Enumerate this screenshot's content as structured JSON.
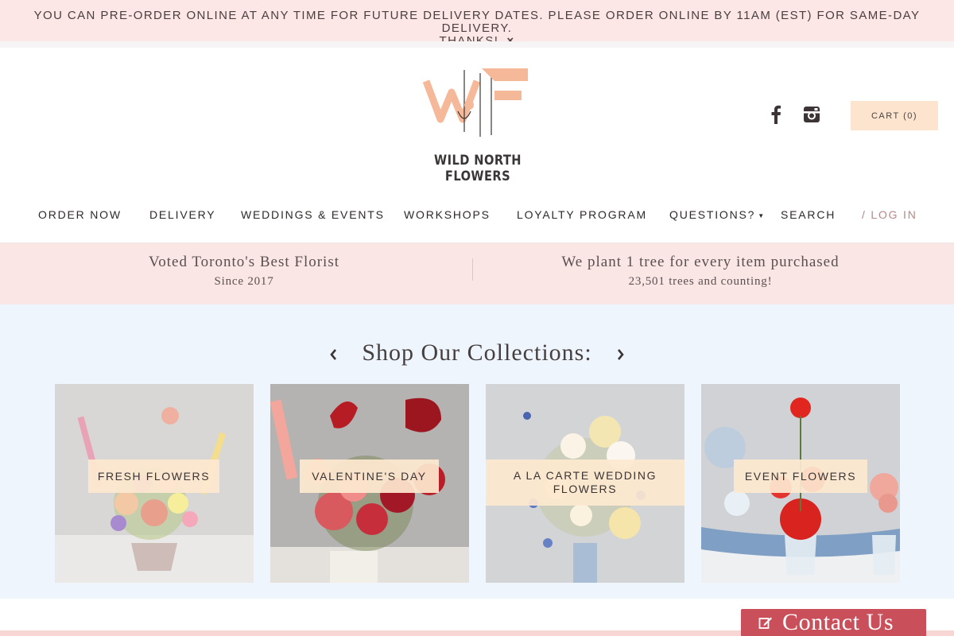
{
  "announcement": {
    "line1": "YOU CAN PRE-ORDER ONLINE AT ANY TIME FOR FUTURE DELIVERY DATES. PLEASE ORDER ONLINE BY 11AM (EST) FOR SAME-DAY DELIVERY.",
    "line2": "THANKS!",
    "close": "×"
  },
  "logo": {
    "text": "WILD NORTH FLOWERS"
  },
  "header": {
    "social": [
      "facebook-icon",
      "instagram-icon"
    ],
    "cart_label": "CART (0)"
  },
  "nav": {
    "items": [
      {
        "label": "ORDER NOW"
      },
      {
        "label": "DELIVERY"
      },
      {
        "label": "WEDDINGS & EVENTS"
      },
      {
        "label": "WORKSHOPS"
      },
      {
        "label": "LOYALTY PROGRAM"
      },
      {
        "label": "QUESTIONS?"
      },
      {
        "label": "SEARCH"
      }
    ],
    "login_label": "/ LOG IN"
  },
  "promo": {
    "left_title": "Voted Toronto's Best Florist",
    "left_sub": "Since 2017",
    "right_title": "We plant 1 tree for every item purchased",
    "right_sub": "23,501 trees and counting!"
  },
  "collections": {
    "title": "Shop Our Collections:",
    "tiles": [
      {
        "label": "FRESH FLOWERS"
      },
      {
        "label": "VALENTINE'S DAY"
      },
      {
        "label": "A LA CARTE WEDDING FLOWERS"
      },
      {
        "label": "EVENT FLOWERS"
      }
    ]
  },
  "contact": {
    "label": "Contact Us"
  },
  "colors": {
    "announcement_bg": "#fde7e6",
    "cart_bg": "#fde4ce",
    "promo_bg": "#f9e6e5",
    "collections_bg": "#eff5fd",
    "contact_bg": "#c9505b",
    "logo_peach": "#f5b99a"
  }
}
